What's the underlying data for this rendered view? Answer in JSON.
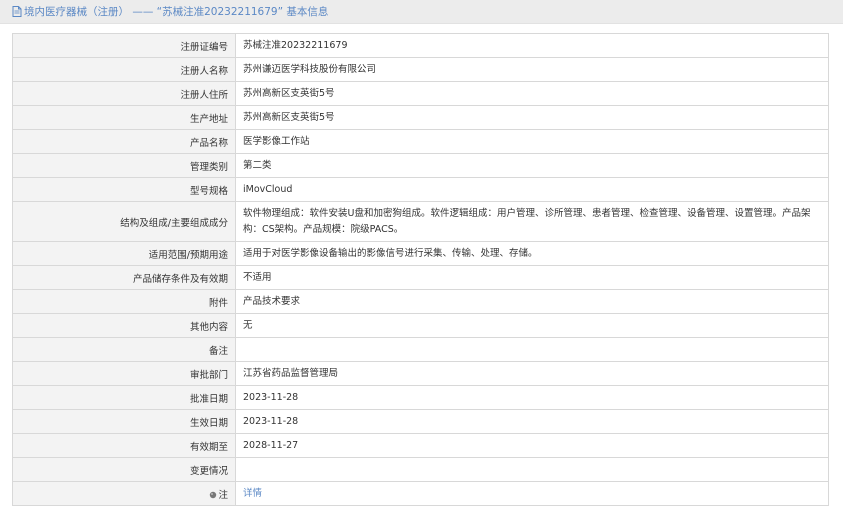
{
  "header": {
    "title": "境内医疗器械（注册） —— “苏械注准20232211679” 基本信息"
  },
  "rows": [
    {
      "label": "注册证编号",
      "value": "苏械注准20232211679"
    },
    {
      "label": "注册人名称",
      "value": "苏州谦迈医学科技股份有限公司"
    },
    {
      "label": "注册人住所",
      "value": "苏州高新区支英街5号"
    },
    {
      "label": "生产地址",
      "value": "苏州高新区支英街5号"
    },
    {
      "label": "产品名称",
      "value": "医学影像工作站"
    },
    {
      "label": "管理类别",
      "value": "第二类"
    },
    {
      "label": "型号规格",
      "value": "iMovCloud"
    },
    {
      "label": "结构及组成/主要组成成分",
      "value": "软件物理组成：软件安装U盘和加密狗组成。软件逻辑组成：用户管理、诊所管理、患者管理、检查管理、设备管理、设置管理。产品架构：CS架构。产品规模：院级PACS。"
    },
    {
      "label": "适用范围/预期用途",
      "value": "适用于对医学影像设备输出的影像信号进行采集、传输、处理、存储。"
    },
    {
      "label": "产品储存条件及有效期",
      "value": "不适用"
    },
    {
      "label": "附件",
      "value": "产品技术要求"
    },
    {
      "label": "其他内容",
      "value": "无"
    },
    {
      "label": "备注",
      "value": ""
    },
    {
      "label": "审批部门",
      "value": "江苏省药品监督管理局"
    },
    {
      "label": "批准日期",
      "value": "2023-11-28"
    },
    {
      "label": "生效日期",
      "value": "2023-11-28"
    },
    {
      "label": "有效期至",
      "value": "2028-11-27"
    },
    {
      "label": "变更情况",
      "value": ""
    },
    {
      "label": "注",
      "value": "详情"
    }
  ],
  "icons": {
    "header_icon": "document-icon",
    "note_icon": "pin-icon"
  },
  "colors": {
    "accent": "#5b88c5",
    "label_bg": "#f3f3f3",
    "header_bg": "#ececec"
  }
}
